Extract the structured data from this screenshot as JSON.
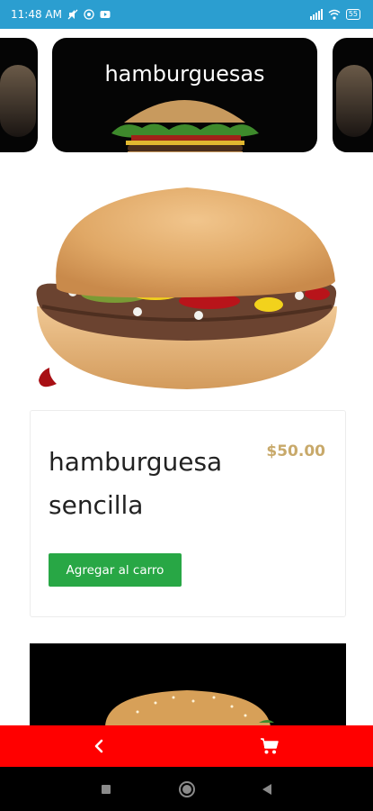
{
  "status_bar": {
    "time": "11:48 AM",
    "battery": "55"
  },
  "category_carousel": {
    "active_category": "hamburguesas"
  },
  "product": {
    "name": "hamburguesa sencilla",
    "price": "$50.00",
    "add_button_label": "Agregar al carro"
  },
  "colors": {
    "status_bar": "#2b9ed0",
    "bottom_bar": "#ff0000",
    "add_button": "#28a745",
    "price": "#c8a96a"
  },
  "bottom_bar": {
    "back_icon": "chevron-left-icon",
    "cart_icon": "shopping-cart-icon"
  },
  "nav_bar": {
    "recents_icon": "square-icon",
    "home_icon": "circle-icon",
    "back_icon": "triangle-back-icon"
  }
}
